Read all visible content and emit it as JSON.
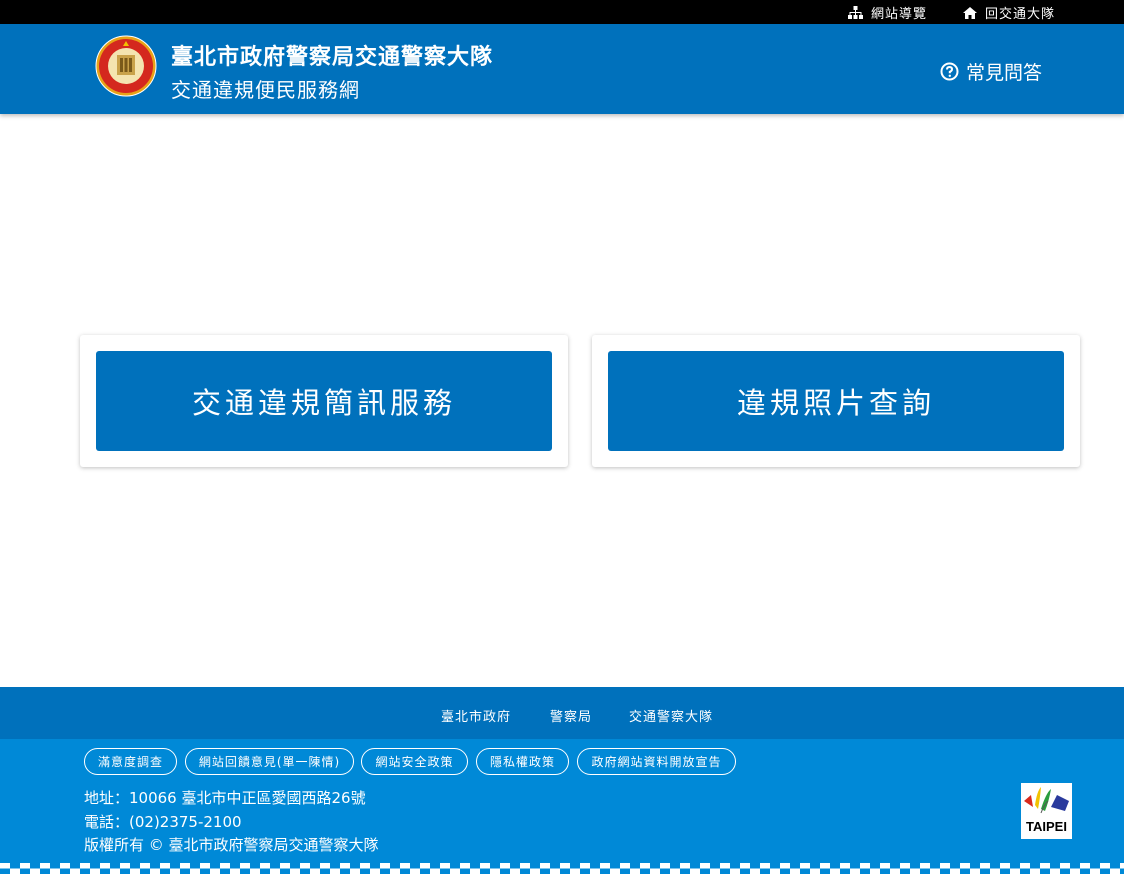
{
  "topbar": {
    "sitemap_label": "網站導覽",
    "sitemap_icon": "sitemap-icon",
    "home_label": "回交通大隊",
    "home_icon": "home-icon"
  },
  "header": {
    "title_main": "臺北市政府警察局交通警察大隊",
    "title_sub": "交通違規便民服務網",
    "faq_label": "常見問答",
    "faq_icon": "question-circle-icon",
    "logo_icon": "police-badge-logo"
  },
  "cards": [
    {
      "label": "交通違規簡訊服務"
    },
    {
      "label": "違規照片查詢"
    }
  ],
  "footer": {
    "nav": [
      "臺北市政府",
      "警察局",
      "交通警察大隊"
    ],
    "pills": [
      "滿意度調查",
      "網站回饋意見(單一陳情)",
      "網站安全政策",
      "隱私權政策",
      "政府網站資料開放宣告"
    ],
    "address": "地址：10066 臺北市中正區愛國西路26號",
    "phone": "電話：(02)2375-2100",
    "copyright": "版權所有 © 臺北市政府警察局交通警察大隊",
    "taipei_logo_text": "TAIPEI"
  },
  "colors": {
    "brand_blue": "#0071bc",
    "footer_blue": "#0089d7",
    "topbar_black": "#000000"
  }
}
